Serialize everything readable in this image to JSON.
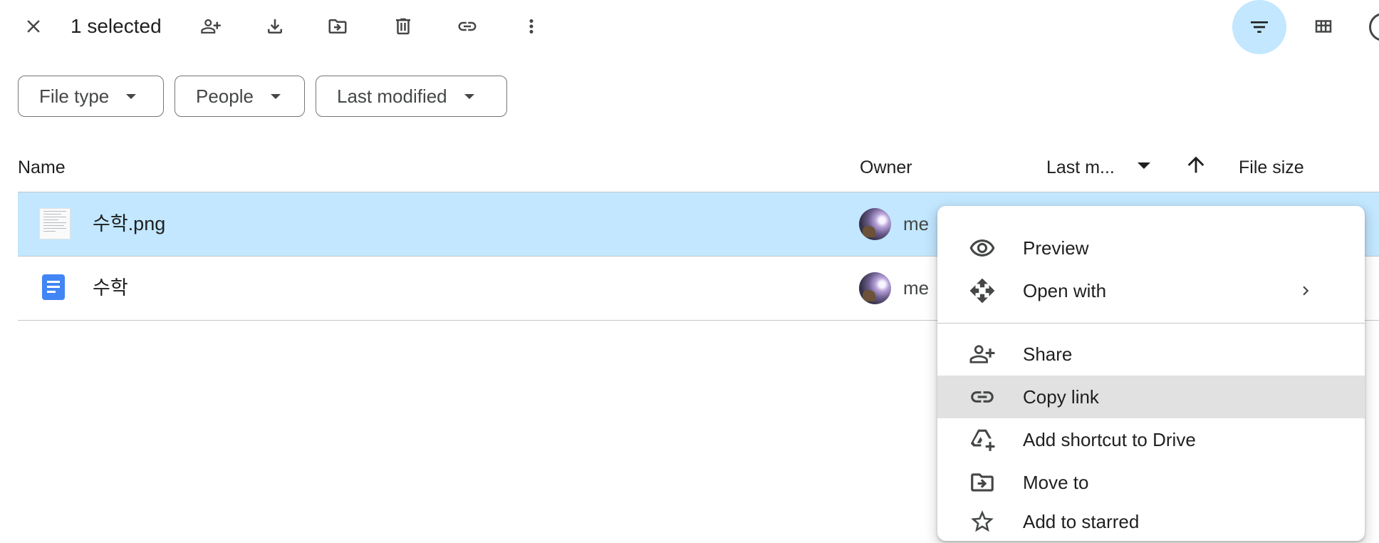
{
  "toolbar": {
    "selected_label": "1 selected",
    "icons": [
      "close-icon",
      "share-icon",
      "download-icon",
      "move-icon",
      "trash-icon",
      "link-icon",
      "more-vert-icon",
      "filter-icon",
      "grid-view-icon"
    ]
  },
  "filters": [
    {
      "label": "File type"
    },
    {
      "label": "People"
    },
    {
      "label": "Last modified"
    }
  ],
  "columns": {
    "name": "Name",
    "owner": "Owner",
    "last_modified": "Last m...",
    "file_size": "File size"
  },
  "files": [
    {
      "name": "수학.png",
      "owner": "me",
      "type": "image",
      "selected": true
    },
    {
      "name": "수학",
      "owner": "me",
      "type": "google-doc",
      "selected": false
    }
  ],
  "context_menu": {
    "items": [
      {
        "label": "Preview",
        "icon": "eye-icon"
      },
      {
        "label": "Open with",
        "icon": "open-with-icon",
        "submenu": true
      },
      {
        "label": "Share",
        "icon": "share-icon"
      },
      {
        "label": "Copy link",
        "icon": "link-icon",
        "highlighted": true
      },
      {
        "label": "Add shortcut to Drive",
        "icon": "add-shortcut-icon"
      },
      {
        "label": "Move to",
        "icon": "move-icon"
      },
      {
        "label": "Add to starred",
        "icon": "star-icon"
      }
    ]
  },
  "colors": {
    "selected_row": "#c2e7ff",
    "accent_toggle": "#c2e7ff",
    "menu_hover": "#e1e1e1",
    "doc_blue": "#4285f4"
  }
}
